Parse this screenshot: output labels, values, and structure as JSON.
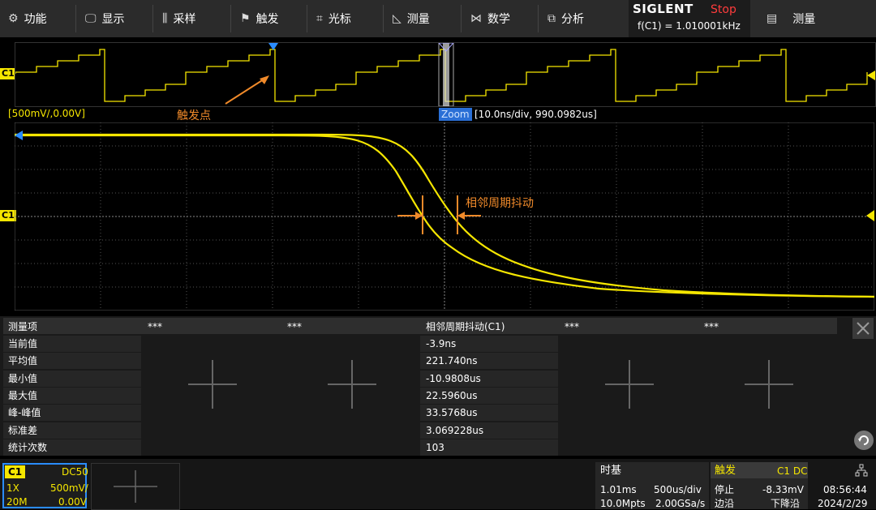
{
  "menu": {
    "items": [
      {
        "label": "功能",
        "icon": "gear-icon",
        "glyph": "⚙"
      },
      {
        "label": "显示",
        "icon": "display-icon",
        "glyph": "🖵"
      },
      {
        "label": "采样",
        "icon": "acquire-icon",
        "glyph": "⫼"
      },
      {
        "label": "触发",
        "icon": "flag-icon",
        "glyph": "⚑"
      },
      {
        "label": "光标",
        "icon": "cursor-icon",
        "glyph": "⌗"
      },
      {
        "label": "测量",
        "icon": "ruler-icon",
        "glyph": "◺"
      },
      {
        "label": "数学",
        "icon": "math-icon",
        "glyph": "⋈"
      },
      {
        "label": "分析",
        "icon": "analysis-icon",
        "glyph": "⧉"
      }
    ],
    "measure_label": "测量"
  },
  "brand": "SIGLENT",
  "run_state": "Stop",
  "frequency": "f(C1) = 1.010001kHz",
  "channel_tag": "C1",
  "scale_label": "[500mV/,0.00V]",
  "zoom": {
    "tag": "Zoom",
    "info": "[10.0ns/div, 990.0982us]"
  },
  "annotations": {
    "trigger_point": "触发点",
    "jitter": "相邻周期抖动"
  },
  "measure": {
    "header": "测量项",
    "stars": "***",
    "column_title": "相邻周期抖动(C1)",
    "rows": [
      {
        "label": "当前值",
        "value": "-3.9ns"
      },
      {
        "label": "平均值",
        "value": "221.740ns"
      },
      {
        "label": "最小值",
        "value": "-10.9808us"
      },
      {
        "label": "最大值",
        "value": "22.5960us"
      },
      {
        "label": "峰-峰值",
        "value": "33.5768us"
      },
      {
        "label": "标准差",
        "value": "3.069228us"
      },
      {
        "label": "统计次数",
        "value": "103"
      }
    ]
  },
  "channel": {
    "name": "C1",
    "coupling": "DC50",
    "probe": "1X",
    "scale": "500mV/",
    "bw": "20M",
    "offset": "0.00V"
  },
  "timebase": {
    "title": "时基",
    "delay": "1.01ms",
    "scale": "500us/div",
    "mem": "10.0Mpts",
    "rate": "2.00GSa/s"
  },
  "trigger": {
    "title": "触发",
    "source": "C1 DC",
    "state": "停止",
    "level": "-8.33mV",
    "edge_label": "边沿",
    "slope": "下降沿"
  },
  "clock": {
    "time": "08:56:44",
    "date": "2024/2/29"
  },
  "colors": {
    "accent": "#f5e600",
    "annot": "#f08a2a",
    "zoom": "#2a6fd6",
    "stop": "#ff3c3c"
  }
}
